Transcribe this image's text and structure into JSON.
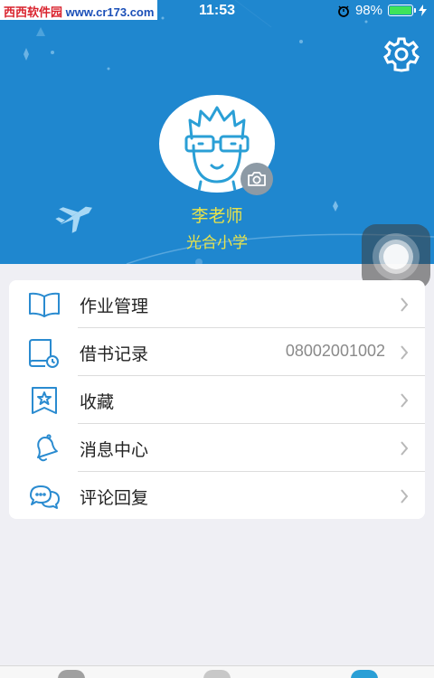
{
  "status_bar": {
    "watermark_part1": "西西软件园",
    "watermark_part2": "www.cr173.com",
    "time": "11:53",
    "battery": "98%",
    "battery_level": 0.98
  },
  "profile": {
    "name": "李老师",
    "school": "光合小学"
  },
  "menu": {
    "items": [
      {
        "label": "作业管理",
        "value": "",
        "icon": "book-open-icon"
      },
      {
        "label": "借书记录",
        "value": "08002001002",
        "icon": "book-clock-icon"
      },
      {
        "label": "收藏",
        "value": "",
        "icon": "star-bookmark-icon"
      },
      {
        "label": "消息中心",
        "value": "",
        "icon": "bell-icon"
      },
      {
        "label": "评论回复",
        "value": "",
        "icon": "chat-bubbles-icon"
      }
    ]
  },
  "colors": {
    "header_bg": "#1f87cf",
    "name_text": "#e9e34a",
    "icon_accent": "#2a8bd0"
  }
}
